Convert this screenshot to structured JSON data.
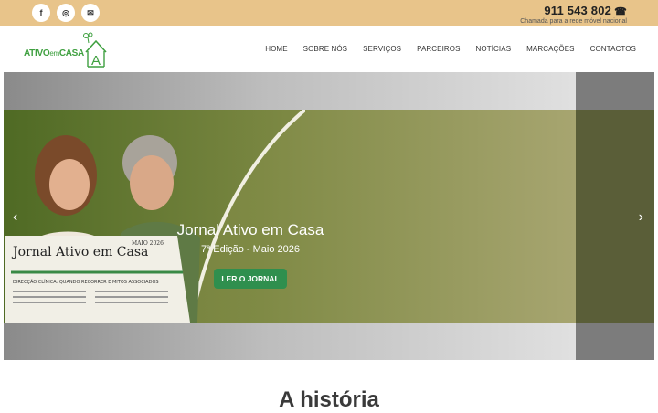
{
  "topbar": {
    "social": [
      {
        "name": "facebook-icon",
        "glyph": "f"
      },
      {
        "name": "instagram-icon",
        "glyph": "◎"
      },
      {
        "name": "email-icon",
        "glyph": "✉"
      }
    ],
    "phone": "911 543 802",
    "phone_icon": "☎",
    "phone_note": "Chamada para a rede móvel nacional"
  },
  "header": {
    "logo_main": "ATIVO",
    "logo_em": "em",
    "logo_casa": "CASA",
    "logo_letter": "A",
    "nav": [
      "HOME",
      "SOBRE NÓS",
      "SERVIÇOS",
      "PARCEIROS",
      "NOTÍCIAS",
      "MARCAÇÕES",
      "CONTACTOS"
    ]
  },
  "hero": {
    "title": "Jornal Ativo em Casa",
    "subtitle": "7ª Edição - Maio 2026",
    "button": "LER O JORNAL",
    "prev_arrow": "‹",
    "next_arrow": "›",
    "newspaper_title": "Jornal Ativo em Casa",
    "newspaper_date": "MAIO 2026",
    "newspaper_headline": "DIRECÇÃO CLÍNICA: QUANDO RECORRER E MITOS ASSOCIADOS"
  },
  "section": {
    "title": "A história"
  },
  "colors": {
    "topbar": "#e8c48a",
    "accent_green": "#2f8f4e",
    "logo_green": "#3fa040"
  }
}
